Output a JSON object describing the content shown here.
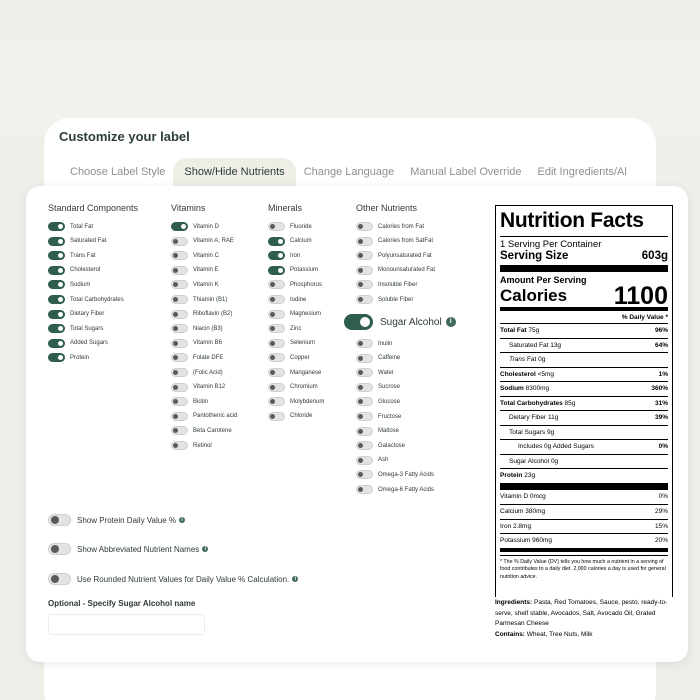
{
  "title": "Customize your label",
  "tabs": [
    "Choose Label Style",
    "Show/Hide Nutrients",
    "Change Language",
    "Manual Label Override",
    "Edit Ingredients/Al"
  ],
  "active_tab": "Show/Hide Nutrients",
  "columns": {
    "standard": {
      "title": "Standard Components",
      "items": [
        {
          "label": "Total Fat",
          "on": true
        },
        {
          "label": "Saturated Fat",
          "on": true
        },
        {
          "label": "Trans Fat",
          "on": true
        },
        {
          "label": "Cholesterol",
          "on": true
        },
        {
          "label": "Sodium",
          "on": true
        },
        {
          "label": "Total Carbohydrates",
          "on": true
        },
        {
          "label": "Dietary Fiber",
          "on": true
        },
        {
          "label": "Total Sugars",
          "on": true
        },
        {
          "label": "Added Sugars",
          "on": true
        },
        {
          "label": "Protein",
          "on": true
        }
      ]
    },
    "vitamins": {
      "title": "Vitamins",
      "items": [
        {
          "label": "Vitamin D",
          "on": true
        },
        {
          "label": "Vitamin A, RAE",
          "on": false
        },
        {
          "label": "Vitamin C",
          "on": false
        },
        {
          "label": "Vitamin E",
          "on": false
        },
        {
          "label": "Vitamin K",
          "on": false
        },
        {
          "label": "Thiamin (B1)",
          "on": false
        },
        {
          "label": "Riboflavin (B2)",
          "on": false
        },
        {
          "label": "Niacin (B3)",
          "on": false
        },
        {
          "label": "Vitamin B6",
          "on": false
        },
        {
          "label": "Folate DFE",
          "on": false
        },
        {
          "label": "(Folic Acid)",
          "on": false
        },
        {
          "label": "Vitamin B12",
          "on": false
        },
        {
          "label": "Biotin",
          "on": false
        },
        {
          "label": "Pantothenic acid",
          "on": false
        },
        {
          "label": "Beta Carotene",
          "on": false
        },
        {
          "label": "Retinol",
          "on": false
        }
      ]
    },
    "minerals": {
      "title": "Minerals",
      "items": [
        {
          "label": "Fluoride",
          "on": false
        },
        {
          "label": "Calcium",
          "on": true
        },
        {
          "label": "Iron",
          "on": true
        },
        {
          "label": "Potassium",
          "on": true
        },
        {
          "label": "Phosphorus",
          "on": false
        },
        {
          "label": "Iodine",
          "on": false
        },
        {
          "label": "Magnesium",
          "on": false
        },
        {
          "label": "Zinc",
          "on": false
        },
        {
          "label": "Selenium",
          "on": false
        },
        {
          "label": "Copper",
          "on": false
        },
        {
          "label": "Manganese",
          "on": false
        },
        {
          "label": "Chromium",
          "on": false
        },
        {
          "label": "Molybdenum",
          "on": false
        },
        {
          "label": "Chloride",
          "on": false
        }
      ]
    },
    "other": {
      "title": "Other Nutrients",
      "items_top": [
        {
          "label": "Calories from Fat",
          "on": false
        },
        {
          "label": "Calories from SatFat",
          "on": false
        },
        {
          "label": "Polyunsaturated Fat",
          "on": false
        },
        {
          "label": "Monounsaturated Fat",
          "on": false
        },
        {
          "label": "Insoluble Fiber",
          "on": false
        },
        {
          "label": "Soluble Fiber",
          "on": false
        }
      ],
      "highlight": {
        "label": "Sugar Alcohol",
        "on": true,
        "info_icon": "info-icon"
      },
      "items_bottom": [
        {
          "label": "Inulin",
          "on": false
        },
        {
          "label": "Caffeine",
          "on": false
        },
        {
          "label": "Water",
          "on": false
        },
        {
          "label": "Sucrose",
          "on": false
        },
        {
          "label": "Glucose",
          "on": false
        },
        {
          "label": "Fructose",
          "on": false
        },
        {
          "label": "Maltose",
          "on": false
        },
        {
          "label": "Galactose",
          "on": false
        },
        {
          "label": "Ash",
          "on": false
        },
        {
          "label": "Omega-3 Fatty Acids",
          "on": false
        },
        {
          "label": "Omega-6 Fatty Acids",
          "on": false
        }
      ]
    }
  },
  "options": [
    {
      "label": "Show Protein Daily Value %",
      "on": false
    },
    {
      "label": "Show Abbreviated Nutrient Names",
      "on": false
    },
    {
      "label": "Use Rounded Nutrient Values for Daily Value % Calculation.",
      "on": false
    }
  ],
  "sugar_alcohol_name": {
    "label": "Optional - Specify Sugar Alcohol name",
    "value": "",
    "placeholder": ""
  },
  "nutrition_label": {
    "title": "Nutrition Facts",
    "servings": "1 Serving Per Container",
    "serving_size_label": "Serving Size",
    "serving_size_value": "603g",
    "amount_per_serving": "Amount Per Serving",
    "calories_label": "Calories",
    "calories_value": "1100",
    "dv_header": "% Daily Value *",
    "lines": [
      {
        "name": "Total Fat",
        "amount": "75g",
        "dv": "96%",
        "bold": true,
        "indent": 0
      },
      {
        "name": "Saturated Fat",
        "amount": "13g",
        "dv": "64%",
        "bold": false,
        "indent": 1
      },
      {
        "name": "Trans",
        "amount": "Fat 0g",
        "dv": "",
        "bold": false,
        "indent": 1,
        "italic_name": true
      },
      {
        "name": "Cholesterol",
        "amount": "<5mg",
        "dv": "1%",
        "bold": true,
        "indent": 0
      },
      {
        "name": "Sodium",
        "amount": "8300mg",
        "dv": "360%",
        "bold": true,
        "indent": 0
      },
      {
        "name": "Total Carbohydrates",
        "amount": "85g",
        "dv": "31%",
        "bold": true,
        "indent": 0
      },
      {
        "name": "Dietary Fiber",
        "amount": "11g",
        "dv": "39%",
        "bold": false,
        "indent": 1
      },
      {
        "name": "Total Sugars",
        "amount": "9g",
        "dv": "",
        "bold": false,
        "indent": 1
      },
      {
        "name": "Includes 0g Added Sugars",
        "amount": "",
        "dv": "0%",
        "bold": false,
        "indent": 2
      },
      {
        "name": "Sugar Alcohol",
        "amount": "0g",
        "dv": "",
        "bold": false,
        "indent": 1
      },
      {
        "name": "Protein",
        "amount": "23g",
        "dv": "",
        "bold": true,
        "indent": 0
      }
    ],
    "micros": [
      {
        "name": "Vitamin D",
        "amount": "0mcg",
        "dv": "0%"
      },
      {
        "name": "Calcium",
        "amount": "380mg",
        "dv": "29%"
      },
      {
        "name": "Iron",
        "amount": "2.8mg",
        "dv": "15%"
      },
      {
        "name": "Potassium",
        "amount": "960mg",
        "dv": "20%"
      }
    ],
    "footnote": "* The % Daily Value (DV) tells you how much a nutrient in a serving of food contributes to a daily diet. 2,000 calories a day is used for general nutrition advice."
  },
  "ingredients_label": "Ingredients:",
  "ingredients": "Pasta, Red Tomatoes, Sauce, pesto, ready-to-serve, shelf stable, Avocados, Salt, Avocado Oil, Grated Parmesan Cheese",
  "contains_label": "Contains:",
  "contains": "Wheat, Tree Nuts, Milk"
}
